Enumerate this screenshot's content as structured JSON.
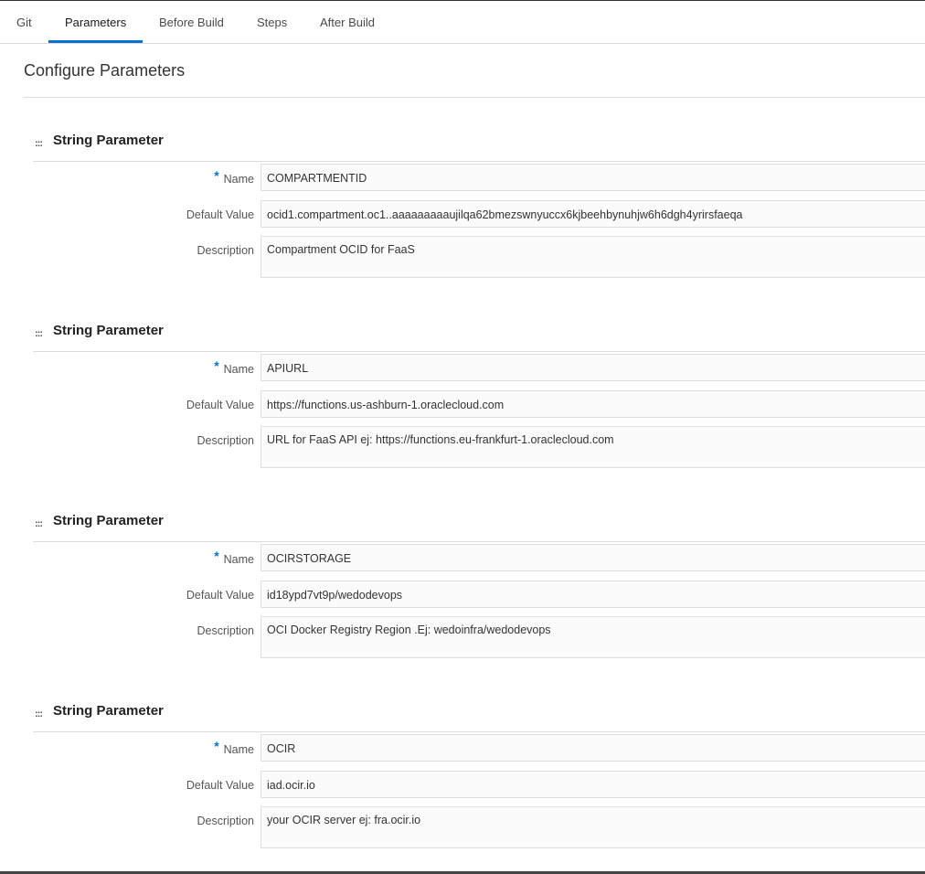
{
  "tabs": [
    {
      "label": "Git"
    },
    {
      "label": "Parameters",
      "active": true
    },
    {
      "label": "Before Build"
    },
    {
      "label": "Steps"
    },
    {
      "label": "After Build"
    }
  ],
  "page_title": "Configure Parameters",
  "labels": {
    "required_marker": "*",
    "name": "Name",
    "default_value": "Default Value",
    "description": "Description"
  },
  "parameters": [
    {
      "type": "String Parameter",
      "name": "COMPARTMENTID",
      "default_value": "ocid1.compartment.oc1..aaaaaaaaaujilqa62bmezswnyuccx6kjbeehbynuhjw6h6dgh4yrirsfaeqa",
      "description": "Compartment OCID for FaaS"
    },
    {
      "type": "String Parameter",
      "name": "APIURL",
      "default_value": "https://functions.us-ashburn-1.oraclecloud.com",
      "description": "URL for FaaS API ej: https://functions.eu-frankfurt-1.oraclecloud.com"
    },
    {
      "type": "String Parameter",
      "name": "OCIRSTORAGE",
      "default_value": "id18ypd7vt9p/wedodevops",
      "description": "OCI Docker Registry Region .Ej: wedoinfra/wedodevops"
    },
    {
      "type": "String Parameter",
      "name": "OCIR",
      "default_value": "iad.ocir.io",
      "description": "your OCIR server ej: fra.ocir.io"
    }
  ],
  "colors": {
    "accent": "#0572ce",
    "border": "#dcdcdc",
    "field_bg": "#fbfbfb"
  },
  "icons": {
    "drag_handle": "drag-handle-icon"
  }
}
